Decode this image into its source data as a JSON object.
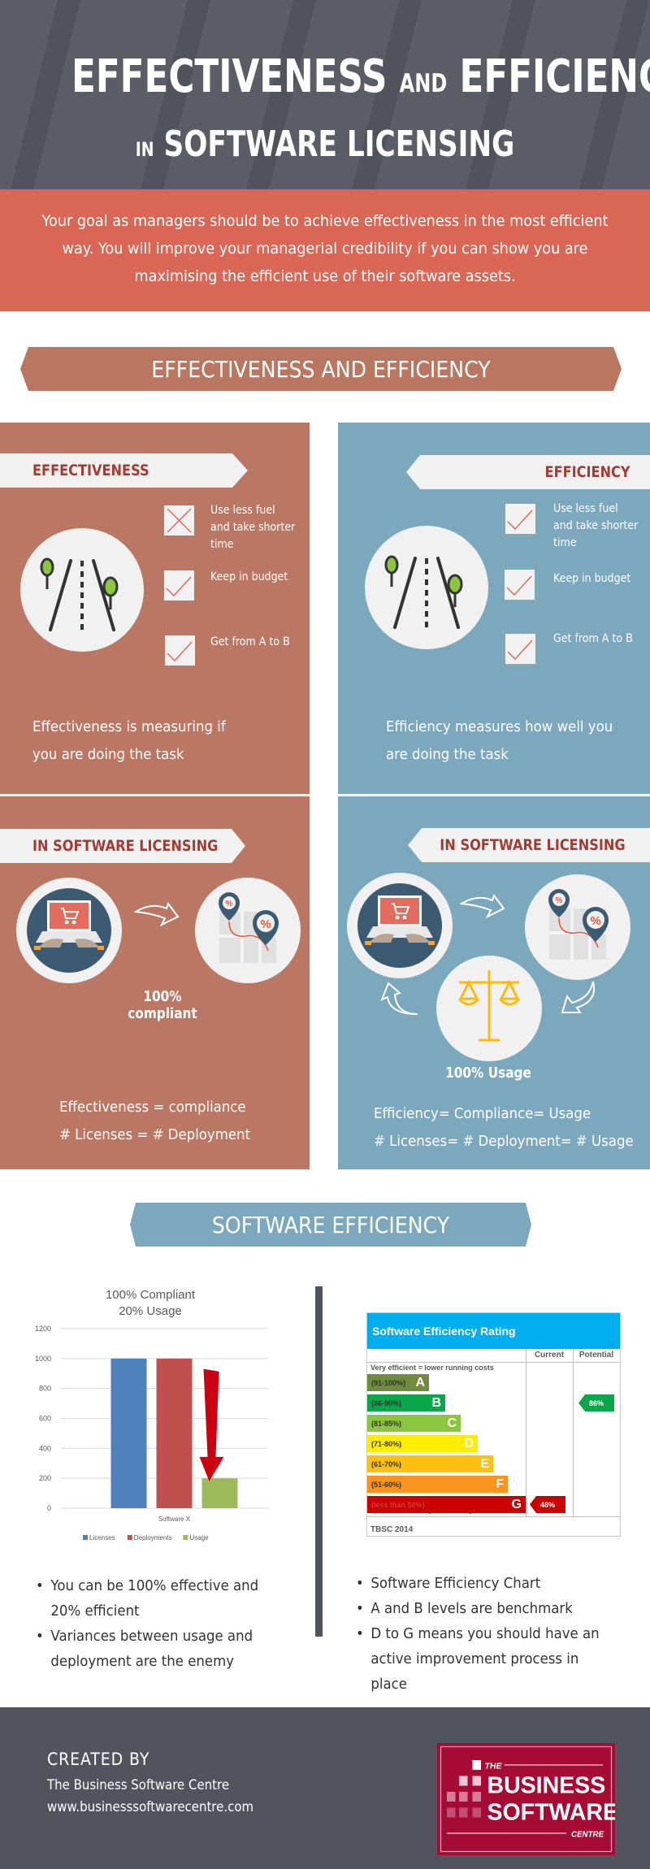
{
  "hero": {
    "line1_part1": "EFFECTIVENESS",
    "line1_small": "AND",
    "line1_part2": "EFFICIENCY",
    "line2_small": "IN",
    "line2_main": "SOFTWARE LICENSING",
    "colors": {
      "background": "#5a5d66",
      "stripe": "#50535c"
    }
  },
  "intro": {
    "text": "Your goal as managers should be to achieve effectiveness in the most efficient way. You will improve your managerial credibility if you can show you are maximising the efficient use of their software assets.",
    "background": "#da6756"
  },
  "section1": {
    "banner": "EFFECTIVENESS AND EFFICIENCY",
    "banner_color": "#b97762"
  },
  "effectiveness": {
    "tag": "EFFECTIVENESS",
    "icon": "road-icon",
    "checklist": [
      {
        "label": "Use less fuel and take shorter time",
        "lines": [
          "Use less fuel",
          "and take shorter",
          "time"
        ],
        "state": "cross"
      },
      {
        "label": "Keep in budget",
        "lines": [
          "Keep in budget"
        ],
        "state": "check"
      },
      {
        "label": "Get from A to B",
        "lines": [
          "Get from A to B"
        ],
        "state": "check"
      }
    ],
    "description": [
      "Effectiveness is  measuring if",
      "you are doing the task"
    ],
    "color": "#ba7763"
  },
  "efficiency": {
    "tag": "EFFICIENCY",
    "icon": "road-icon",
    "checklist": [
      {
        "label": "Use less fuel and take shorter time",
        "lines": [
          "Use less fuel",
          "and take shorter",
          "time"
        ],
        "state": "check"
      },
      {
        "label": "Keep in budget",
        "lines": [
          "Keep in budget"
        ],
        "state": "check"
      },
      {
        "label": "Get from A to B",
        "lines": [
          "Get from A to B"
        ],
        "state": "check"
      }
    ],
    "description": [
      "Efficiency measures how well you",
      "are doing the task"
    ],
    "color": "#7ca8be"
  },
  "licensing_left": {
    "tag": "IN SOFTWARE LICENSING",
    "icons": [
      "laptop-shopping-icon",
      "arrow-icon",
      "map-pins-percent-icon"
    ],
    "caption": "100% compliant",
    "equations": [
      "Effectiveness = compliance",
      "# Licenses = # Deployment"
    ]
  },
  "licensing_right": {
    "tag": "IN SOFTWARE LICENSING",
    "icons": [
      "laptop-shopping-icon",
      "arrow-icon",
      "map-pins-percent-icon",
      "scales-icon"
    ],
    "caption": "100% Usage",
    "equations": [
      "Efficiency= Compliance= Usage",
      "# Licenses= # Deployment= # Usage"
    ]
  },
  "section2": {
    "banner": "SOFTWARE EFFICIENCY",
    "banner_color": "#7ca8be"
  },
  "chart_data": [
    {
      "type": "bar",
      "title": "100% Compliant\n20% Usage",
      "title_lines": [
        "100% Compliant",
        "20% Usage"
      ],
      "categories": [
        "Software X"
      ],
      "series": [
        {
          "name": "Licenses",
          "values": [
            1000
          ],
          "color": "#4f81bd"
        },
        {
          "name": "Deployments",
          "values": [
            1000
          ],
          "color": "#c0504d"
        },
        {
          "name": "Usage",
          "values": [
            200
          ],
          "color": "#9bbb59"
        }
      ],
      "yticks": [
        0,
        200,
        400,
        600,
        800,
        1000,
        1200
      ],
      "ylim": [
        0,
        1200
      ],
      "xlabel": "",
      "ylabel": "",
      "grid": true,
      "legend": "bottom",
      "annotation": {
        "type": "arrow",
        "from": 930,
        "to": 180,
        "color": "#cc0011"
      }
    },
    {
      "type": "table",
      "title": "Software Efficiency Rating",
      "columns": [
        "",
        "Current",
        "Potential"
      ],
      "top_note": "Very efficient = lower running costs",
      "bottom_note": "Not efficient = higher running costs",
      "footer": "TBSC 2014",
      "bands": [
        {
          "range": "(91-100%)",
          "letter": "A",
          "color": "#6f8b3d"
        },
        {
          "range": "(86-90%)",
          "letter": "B",
          "color": "#0aa64a"
        },
        {
          "range": "(81-85%)",
          "letter": "C",
          "color": "#8cc63f"
        },
        {
          "range": "(71-80%)",
          "letter": "D",
          "color": "#ffed00"
        },
        {
          "range": "(61-70%)",
          "letter": "E",
          "color": "#fdc010"
        },
        {
          "range": "(51-60%)",
          "letter": "F",
          "color": "#f7941d"
        },
        {
          "range": "(less than 50%)",
          "letter": "G",
          "color": "#cc0000"
        }
      ],
      "current": {
        "value": "48%",
        "band": "G",
        "color": "#cc0000"
      },
      "potential": {
        "value": "86%",
        "band": "B",
        "color": "#0aa64a"
      }
    }
  ],
  "bullets_left": [
    "You can be 100% effective and 20% efficient",
    "Variances between usage and deployment are the enemy"
  ],
  "bullets_right": [
    "Software Efficiency Chart",
    "A and B levels are benchmark",
    "D to G means you should have an active improvement process in place"
  ],
  "footer": {
    "created_by": "CREATED  BY",
    "company": "The Business Software Centre",
    "website": "www.businesssoftwarecentre.com",
    "logo": {
      "the": "THE",
      "line1": "BUSINESS",
      "line2": "SOFTWARE",
      "line3": "CENTRE",
      "color": "#a50b35"
    }
  }
}
